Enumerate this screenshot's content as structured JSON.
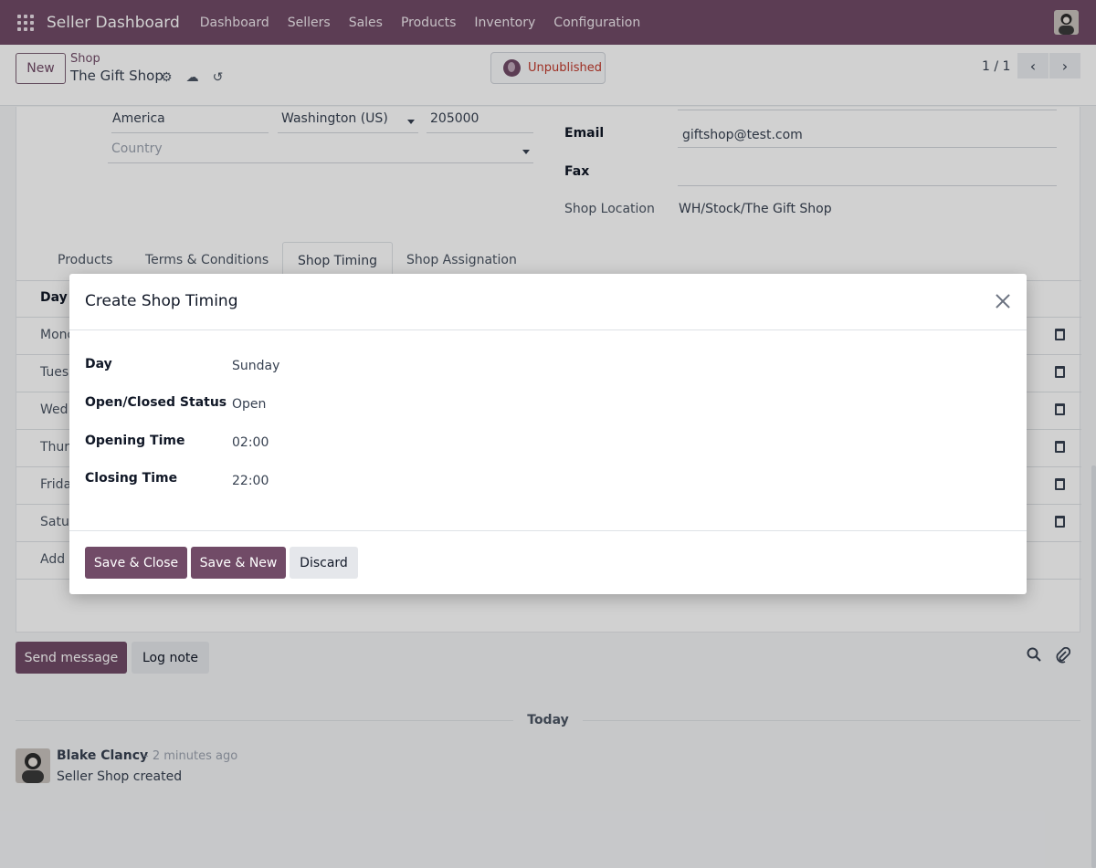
{
  "navbar": {
    "brand": "Seller Dashboard",
    "menu": [
      "Dashboard",
      "Sellers",
      "Sales",
      "Products",
      "Inventory",
      "Configuration"
    ]
  },
  "control_panel": {
    "new_label": "New",
    "breadcrumb_parent": "Shop",
    "breadcrumb_current": "The Gift Shop",
    "status_label": "Unpublished",
    "pager": "1 / 1"
  },
  "form": {
    "street_city": "America",
    "state": "Washington (US)",
    "zip": "205000",
    "country_placeholder": "Country",
    "email_label": "Email",
    "email_value": "giftshop@test.com",
    "fax_label": "Fax",
    "fax_value": "",
    "shop_location_label": "Shop Location",
    "shop_location_value": "WH/Stock/The Gift Shop"
  },
  "tabs": [
    "Products",
    "Terms & Conditions",
    "Shop Timing",
    "Shop Assignation"
  ],
  "timing_table": {
    "column_day": "Day",
    "rows": [
      "Mond",
      "Tues",
      "Wed",
      "Thur",
      "Frida",
      "Satur"
    ],
    "add_line": "Add a"
  },
  "chatter": {
    "send_label": "Send message",
    "log_label": "Log note",
    "today": "Today",
    "author": "Blake Clancy",
    "time": "- 2 minutes ago",
    "body": "Seller Shop created"
  },
  "modal": {
    "title": "Create Shop Timing",
    "fields": [
      {
        "label": "Day",
        "value": "Sunday"
      },
      {
        "label": "Open/Closed Status",
        "value": "Open"
      },
      {
        "label": "Opening Time",
        "value": "02:00"
      },
      {
        "label": "Closing Time",
        "value": "22:00"
      }
    ],
    "save_close": "Save & Close",
    "save_new": "Save & New",
    "discard": "Discard"
  }
}
